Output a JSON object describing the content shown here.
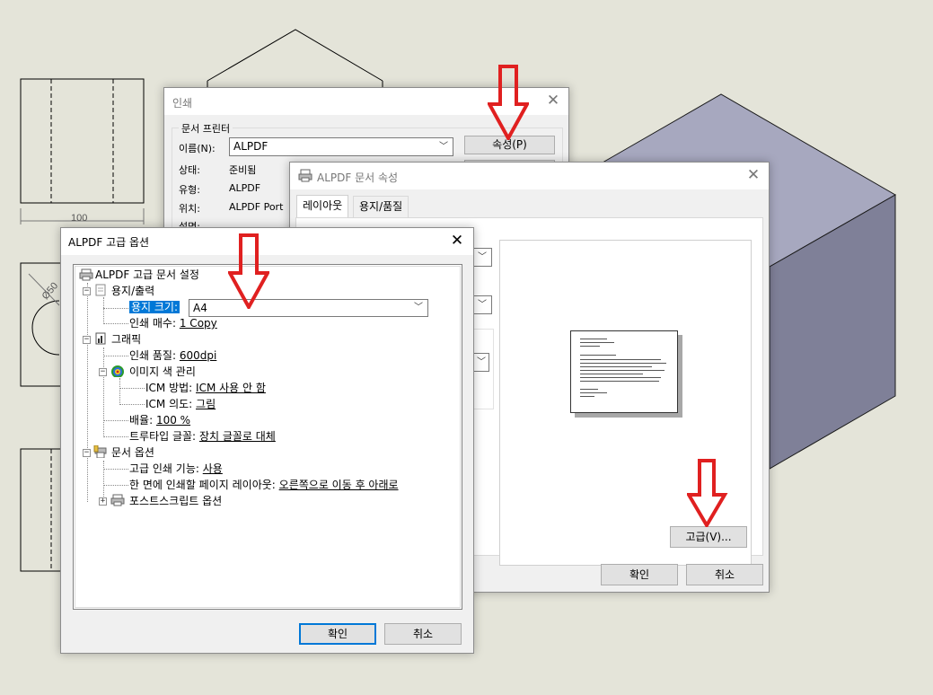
{
  "drawing": {
    "dimension_100": "100",
    "dimension_dia50": "Ø50"
  },
  "print_dialog": {
    "title": "인쇄",
    "group_label": "문서 프린터",
    "name_label": "이름(N):",
    "printer_name": "ALPDF",
    "properties_button": "속성(P)",
    "status_label": "상태:",
    "status_value": "준비됨",
    "type_label": "유형:",
    "type_value": "ALPDF",
    "where_label": "위치:",
    "where_value": "ALPDF Port",
    "comment_label": "설명:"
  },
  "props_dialog": {
    "title": "ALPDF 문서 속성",
    "tabs": [
      {
        "label": "레이아웃"
      },
      {
        "label": "용지/품질"
      }
    ],
    "advanced_button": "고급(V)...",
    "ok_button": "확인",
    "cancel_button": "취소"
  },
  "adv_dialog": {
    "title": "ALPDF 고급 옵션",
    "root": "ALPDF 고급 문서 설정",
    "paper_output": "용지/출력",
    "paper_size_label": "용지 크기:",
    "paper_size_value": "A4",
    "copies_label": "인쇄 매수:",
    "copies_value": "1 Copy",
    "graphics": "그래픽",
    "print_quality_label": "인쇄 품질:",
    "print_quality_value": "600dpi",
    "icm": "이미지 색 관리",
    "icm_method_label": "ICM 방법:",
    "icm_method_value": "ICM 사용 안 함",
    "icm_intent_label": "ICM 의도:",
    "icm_intent_value": "그림",
    "scaling_label": "배율:",
    "scaling_value": "100 %",
    "truetype_label": "트루타입 글꼴:",
    "truetype_value": "장치 글꼴로 대체",
    "doc_options": "문서 옵션",
    "advanced_features_label": "고급 인쇄 기능:",
    "advanced_features_value": "사용",
    "pages_per_sheet_label": "한 면에 인쇄할 페이지 레이아웃:",
    "pages_per_sheet_value": "오른쪽으로 이동 후 아래로",
    "postscript": "포스트스크립트 옵션",
    "ok_button": "확인",
    "cancel_button": "취소"
  },
  "colors": {
    "accent": "#0078d7",
    "arrow": "#e02020",
    "cube_side": "#7f8098",
    "cube_top": "#a7a8bf"
  }
}
